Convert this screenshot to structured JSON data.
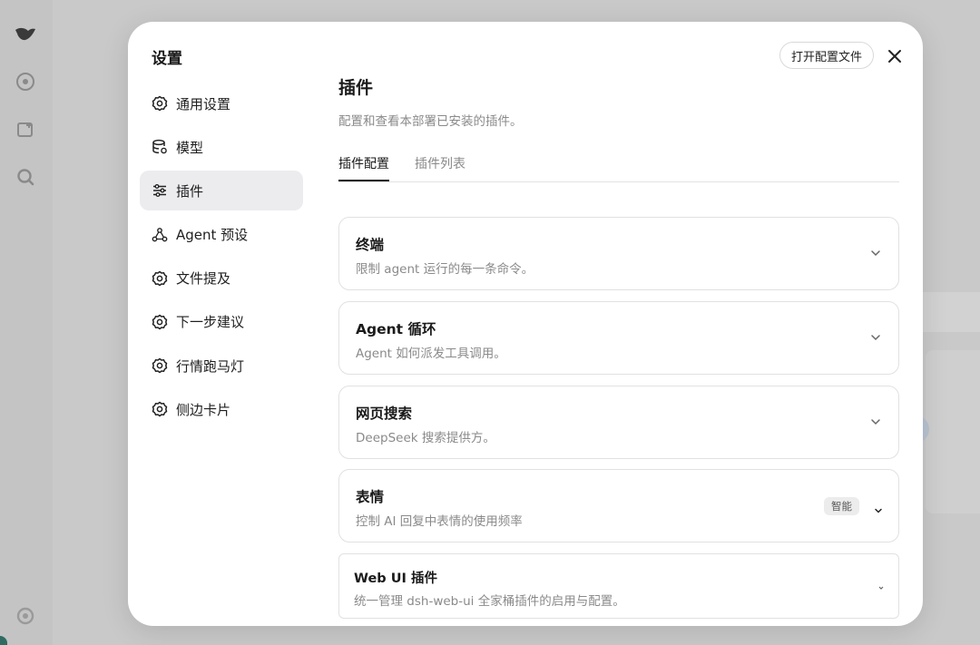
{
  "modal": {
    "title": "设置",
    "open_config_label": "打开配置文件"
  },
  "sidebar": {
    "items": [
      {
        "label": "通用设置",
        "icon": "gear-icon"
      },
      {
        "label": "模型",
        "icon": "database-icon"
      },
      {
        "label": "插件",
        "icon": "sliders-icon",
        "active": true
      },
      {
        "label": "Agent 预设",
        "icon": "agent-icon"
      },
      {
        "label": "文件提及",
        "icon": "gear-icon"
      },
      {
        "label": "下一步建议",
        "icon": "gear-icon"
      },
      {
        "label": "行情跑马灯",
        "icon": "gear-icon"
      },
      {
        "label": "侧边卡片",
        "icon": "gear-icon"
      }
    ]
  },
  "main": {
    "title": "插件",
    "subtitle": "配置和查看本部署已安装的插件。",
    "tabs": [
      {
        "label": "插件配置",
        "active": true
      },
      {
        "label": "插件列表",
        "active": false
      }
    ],
    "cards": [
      {
        "title": "终端",
        "description": "限制 agent 运行的每一条命令。"
      },
      {
        "title": "Agent 循环",
        "description": "Agent 如何派发工具调用。"
      },
      {
        "title": "网页搜索",
        "description": "DeepSeek 搜索提供方。"
      },
      {
        "title": "表情",
        "description": "控制 AI 回复中表情的使用频率",
        "badge": "智能"
      },
      {
        "title": "Web UI 插件",
        "description": "统一管理 dsh-web-ui 全家桶插件的启用与配置。"
      }
    ]
  },
  "colors": {
    "modal_bg": "#ffffff",
    "overlay_bg": "#c9c9c9",
    "active_nav_bg": "#ececef",
    "muted_text": "#8a8a8a",
    "border": "#e1e1e1"
  }
}
